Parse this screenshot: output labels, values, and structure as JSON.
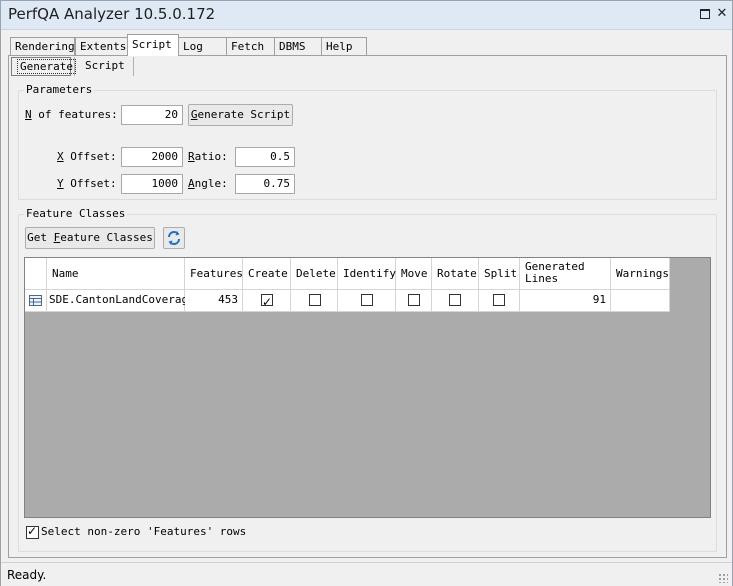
{
  "window": {
    "title": "PerfQA Analyzer 10.5.0.172",
    "maximize_icon": "maximize-icon",
    "close_glyph": "✕"
  },
  "tabs": [
    {
      "label": "Rendering"
    },
    {
      "label": "Extents"
    },
    {
      "label": "Script"
    },
    {
      "label": "Log"
    },
    {
      "label": "Fetch"
    },
    {
      "label": "DBMS"
    },
    {
      "label": "Help"
    }
  ],
  "active_tab": "Script",
  "subtabs": [
    {
      "label": "Generate"
    },
    {
      "label": "Script"
    }
  ],
  "parameters": {
    "title": "Parameters",
    "pct_label_hot": "N",
    "pct_label_rest": " of features:",
    "pct_value": "20",
    "generate_hot": "G",
    "generate_rest": "enerate Script",
    "xoffset_hot": "X",
    "xoffset_rest": " Offset:",
    "xoffset_value": "2000",
    "yoffset_hot": "Y",
    "yoffset_rest": " Offset:",
    "yoffset_value": "1000",
    "ratio_hot": "R",
    "ratio_rest": "atio:",
    "ratio_value": "0.5",
    "angle_hot": "A",
    "angle_rest": "ngle:",
    "angle_value": "0.75"
  },
  "feature_classes": {
    "title": "Feature Classes",
    "get_pre": "Get ",
    "get_hot": "F",
    "get_rest": "eature Classes",
    "refresh_icon": "refresh-icon",
    "columns": [
      "Name",
      "Features",
      "Create",
      "Delete",
      "Identify",
      "Move",
      "Rotate",
      "Split",
      "Generated Lines",
      "Warnings"
    ],
    "rows": [
      {
        "row_icon": "table-icon",
        "name": "SDE.CantonLandCoverage",
        "features": "453",
        "create": true,
        "delete": false,
        "identify": false,
        "move": false,
        "rotate": false,
        "split": false,
        "generated_lines": "91",
        "warnings": ""
      }
    ],
    "select_nonzero_label": "Select non-zero 'Features' rows",
    "select_nonzero_checked": true
  },
  "status": {
    "text": "Ready."
  },
  "colors": {
    "titlebar": "#dfe9f5",
    "grid_bg": "#ababab",
    "accent": "#1e72c8"
  }
}
